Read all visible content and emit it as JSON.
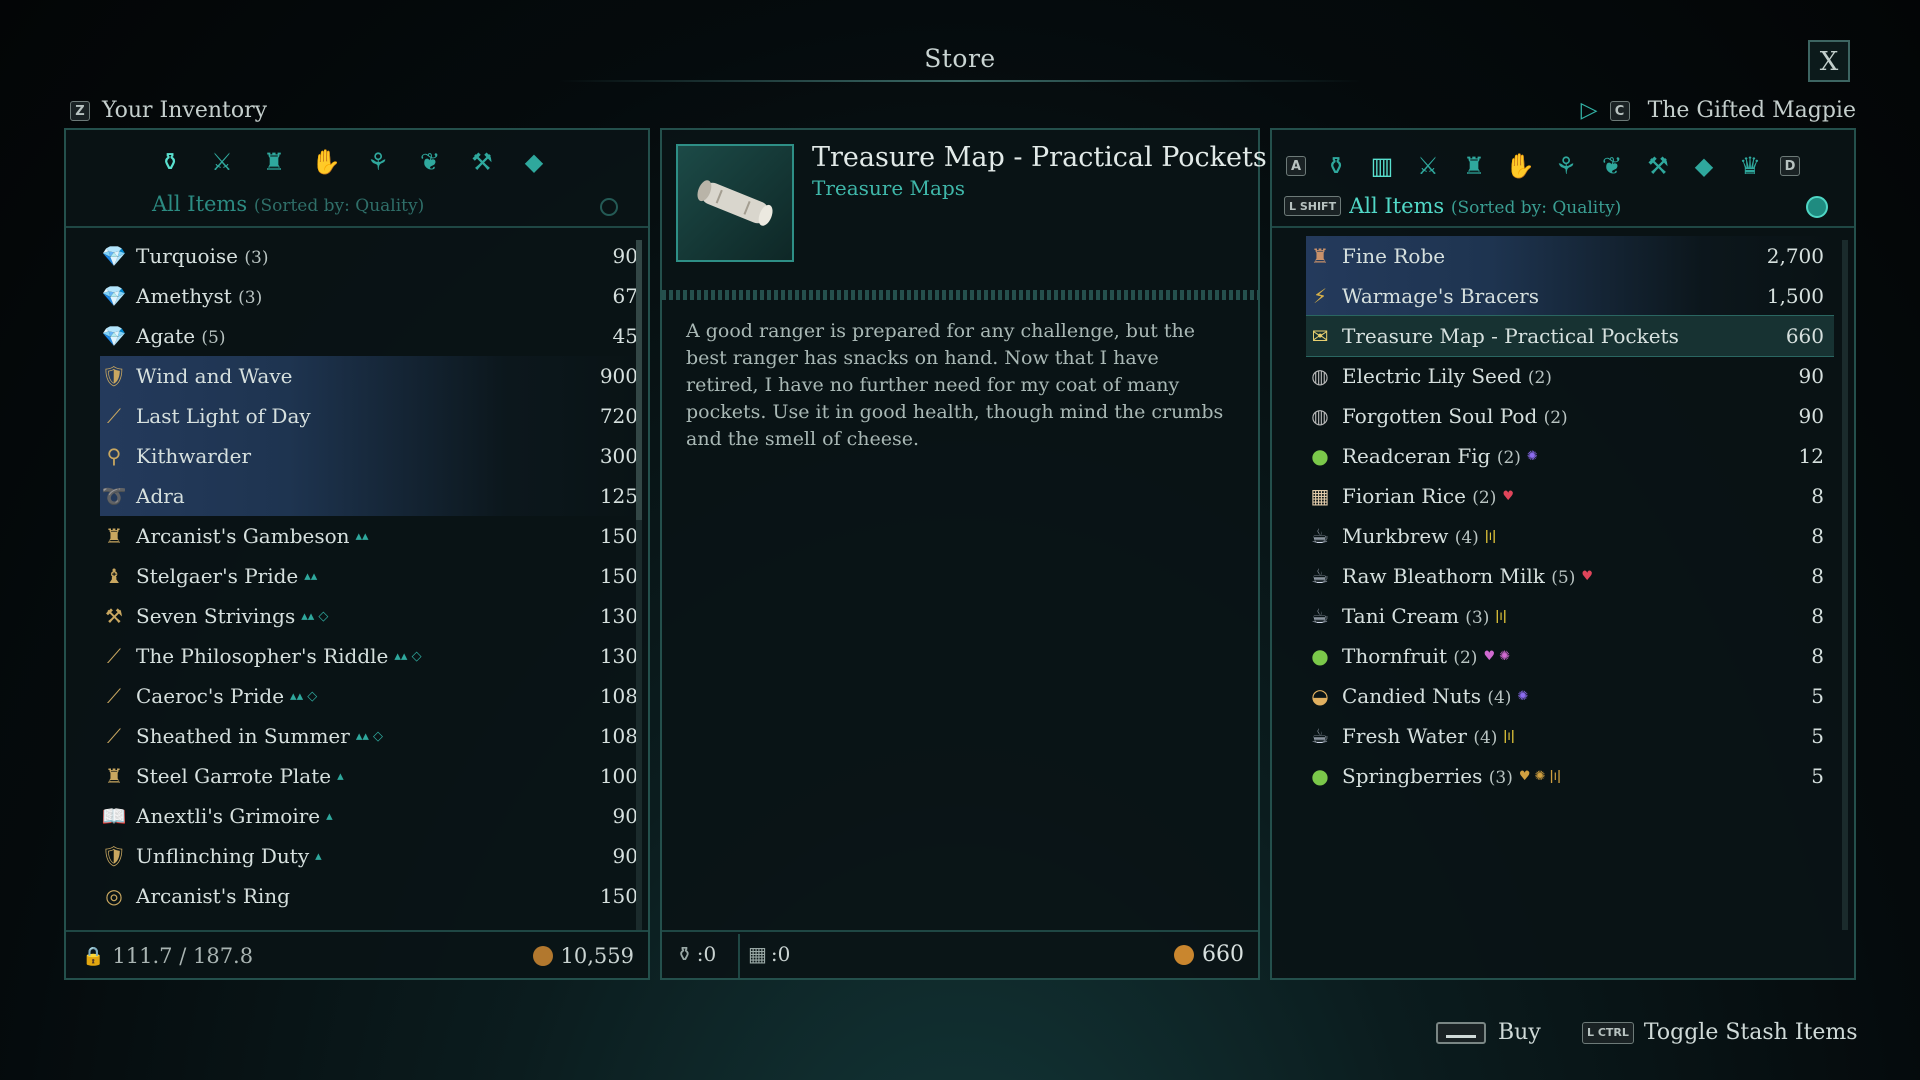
{
  "title": "Store",
  "close_label": "X",
  "left": {
    "key": "Z",
    "header": "Your Inventory",
    "sort_main": "All Items",
    "sort_by": "(Sorted by: Quality)",
    "weight": "111.7 / 187.8",
    "gold": "10,559",
    "items": [
      {
        "name": "Turquoise",
        "count": "(3)",
        "value": "90",
        "icon": "💎",
        "color": "#8a8fd6"
      },
      {
        "name": "Amethyst",
        "count": "(3)",
        "value": "67",
        "icon": "💎",
        "color": "#8a8fd6"
      },
      {
        "name": "Agate",
        "count": "(5)",
        "value": "45",
        "icon": "💎",
        "color": "#8a8fd6"
      },
      {
        "name": "Wind and Wave",
        "count": "",
        "value": "900",
        "icon": "🛡",
        "color": "#c9a760",
        "equip": "◈",
        "hl": true
      },
      {
        "name": "Last Light of Day",
        "count": "",
        "value": "720",
        "icon": "⟋",
        "color": "#c9a760",
        "equip": "◈",
        "hl": true
      },
      {
        "name": "Kithwarder",
        "count": "",
        "value": "300",
        "icon": "⚲",
        "color": "#c9a760",
        "equip": "◈",
        "hl": true
      },
      {
        "name": "Adra",
        "count": "",
        "value": "125",
        "icon": "➰",
        "color": "#c9a760",
        "hl": true
      },
      {
        "name": "Arcanist's Gambeson",
        "count": "",
        "value": "150",
        "icon": "♜",
        "color": "#c9a760",
        "tags": "▴▴"
      },
      {
        "name": "Stelgaer's Pride",
        "count": "",
        "value": "150",
        "icon": "♝",
        "color": "#c9a760",
        "equip": "◈",
        "tags": "▴▴"
      },
      {
        "name": "Seven Strivings",
        "count": "",
        "value": "130",
        "icon": "⚒",
        "color": "#c9a760",
        "tags": "▴▴ ◇"
      },
      {
        "name": "The Philosopher's Riddle",
        "count": "",
        "value": "130",
        "icon": "⟋",
        "color": "#c9a760",
        "tags": "▴▴ ◇"
      },
      {
        "name": "Caeroc's Pride",
        "count": "",
        "value": "108",
        "icon": "⟋",
        "color": "#c9a760",
        "equip": "◇",
        "tags": "▴▴ ◇"
      },
      {
        "name": "Sheathed in Summer",
        "count": "",
        "value": "108",
        "icon": "⟋",
        "color": "#c9a760",
        "tags": "▴▴ ◇"
      },
      {
        "name": "Steel Garrote Plate",
        "count": "",
        "value": "100",
        "icon": "♜",
        "color": "#c9a760",
        "tags": "▴"
      },
      {
        "name": "Anextli's Grimoire",
        "count": "",
        "value": "90",
        "icon": "📖",
        "color": "#c9a760",
        "tags": "▴"
      },
      {
        "name": "Unflinching Duty",
        "count": "",
        "value": "90",
        "icon": "🛡",
        "color": "#c9a760",
        "tags": "▴"
      },
      {
        "name": "Arcanist's Ring",
        "count": "",
        "value": "150",
        "icon": "◎",
        "color": "#c9a760"
      }
    ]
  },
  "center": {
    "item_name": "Treasure Map - Practical Pockets",
    "item_type": "Treasure Maps",
    "description": "A good ranger is prepared for any challenge, but the best ranger has snacks on hand. Now that I have retired, I have no further need for my coat of many pockets. Use it in good health, though mind the crumbs and the smell of cheese.",
    "bag_count": ":0",
    "stash_count": ":0",
    "price": "660"
  },
  "right": {
    "key": "C",
    "header": "The Gifted Magpie",
    "key_prev": "A",
    "key_next": "D",
    "shift_key": "L SHIFT",
    "sort_main": "All Items",
    "sort_by": "(Sorted by: Quality)",
    "items": [
      {
        "name": "Fine Robe",
        "count": "",
        "value": "2,700",
        "icon": "♜",
        "color": "#c9916a",
        "hl": true
      },
      {
        "name": "Warmage's Bracers",
        "count": "",
        "value": "1,500",
        "icon": "⚡",
        "color": "#d6b04a",
        "hl": true
      },
      {
        "name": "Treasure Map - Practical Pockets",
        "count": "",
        "value": "660",
        "icon": "✉",
        "color": "#e8d070",
        "selected": true
      },
      {
        "name": "Electric Lily Seed",
        "count": "(2)",
        "value": "90",
        "icon": "◍",
        "color": "#b9b9b9"
      },
      {
        "name": "Forgotten Soul Pod",
        "count": "(2)",
        "value": "90",
        "icon": "◍",
        "color": "#b9b9b9"
      },
      {
        "name": "Readceran Fig",
        "count": "(2)",
        "value": "12",
        "icon": "●",
        "color": "#7bc84a",
        "tags": "✺",
        "tagcolor": "#8d6cf0"
      },
      {
        "name": "Fiorian Rice",
        "count": "(2)",
        "value": "8",
        "icon": "▦",
        "color": "#e0c9a8",
        "tags": "♥",
        "tagcolor": "#e0455a"
      },
      {
        "name": "Murkbrew",
        "count": "(4)",
        "value": "8",
        "icon": "☕",
        "color": "#cfd8e8",
        "tags": "ǀıǀ",
        "tagcolor": "#e0c43a"
      },
      {
        "name": "Raw Bleathorn Milk",
        "count": "(5)",
        "value": "8",
        "icon": "☕",
        "color": "#cfd8e8",
        "tags": "♥",
        "tagcolor": "#e0455a"
      },
      {
        "name": "Tani Cream",
        "count": "(3)",
        "value": "8",
        "icon": "☕",
        "color": "#cfd8e8",
        "tags": "ǀıǀ",
        "tagcolor": "#e0c43a"
      },
      {
        "name": "Thornfruit",
        "count": "(2)",
        "value": "8",
        "icon": "●",
        "color": "#7bc84a",
        "tags": "♥ ✺",
        "tagcolor": "#d06ad0"
      },
      {
        "name": "Candied Nuts",
        "count": "(4)",
        "value": "5",
        "icon": "◒",
        "color": "#e0b060",
        "tags": "✺",
        "tagcolor": "#8d6cf0"
      },
      {
        "name": "Fresh Water",
        "count": "(4)",
        "value": "5",
        "icon": "☕",
        "color": "#cfd8e8",
        "tags": "ǀıǀ",
        "tagcolor": "#e0c43a"
      },
      {
        "name": "Springberries",
        "count": "(3)",
        "value": "5",
        "icon": "●",
        "color": "#7bc84a",
        "tags": "♥ ✺ ǀıǀ",
        "tagcolor": "#d0a040"
      }
    ]
  },
  "footer": {
    "buy_label": "Buy",
    "ctrl_key": "L CTRL",
    "toggle_label": "Toggle Stash Items"
  }
}
